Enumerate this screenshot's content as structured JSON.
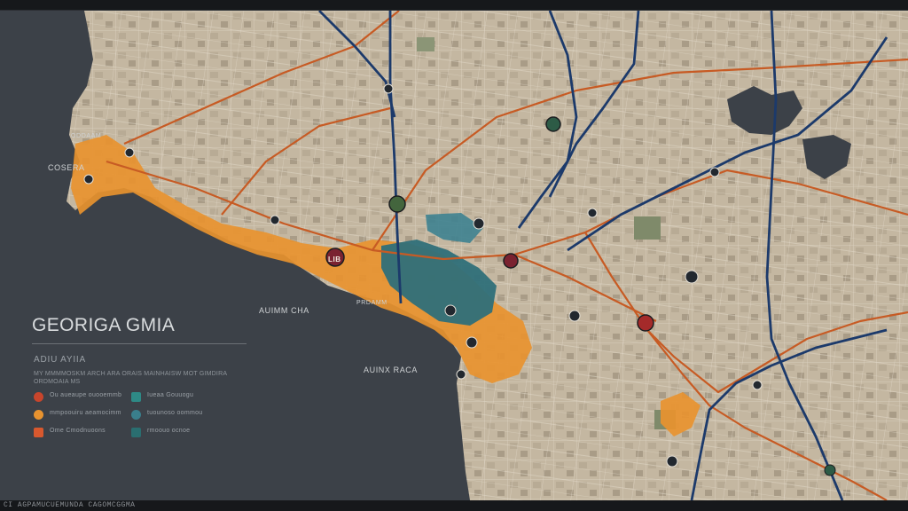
{
  "map": {
    "title": "GEORIGA GMIA",
    "subtitle": "ADIU AYIIA",
    "description": "MY MMMMOSKM ARCH ARA ORAIS MAINHAISW MOT GIMDIRA ORDMOAIA MS",
    "labels": {
      "city_upper": "COSERA",
      "city_upper_2": "ODDAAM",
      "bay": "AUIMM CHA",
      "bay_2": "PRDAMM",
      "south_area": "AUINX RACA",
      "marker_badge": "LIB"
    },
    "footer": "CI AGPAMUCUEMUNDA CAGOMCGGMA",
    "legend": [
      {
        "label": "Ou aueaupe ouooemmb",
        "color": "#c8452c",
        "shape": "circle"
      },
      {
        "label": "mmpoouiru aeamocimm",
        "color": "#e8932f",
        "shape": "circle"
      },
      {
        "label": "Ome Cmodnuoons",
        "color": "#d8582e",
        "shape": "square"
      },
      {
        "label": "Iueaa Gouuogu",
        "color": "#2e8a86",
        "shape": "square"
      },
      {
        "label": "tuounoso oommou",
        "color": "#3a7f8c",
        "shape": "circle"
      },
      {
        "label": "rmoouo ocnoe",
        "color": "#2a6e70",
        "shape": "square"
      }
    ],
    "colors": {
      "land": "#c4b7a1",
      "water": "#3c4148",
      "highway_blue": "#1c3a6b",
      "highway_orange": "#c75b24",
      "urban_orange": "#e8932f",
      "urban_teal": "#2f6f79"
    }
  }
}
